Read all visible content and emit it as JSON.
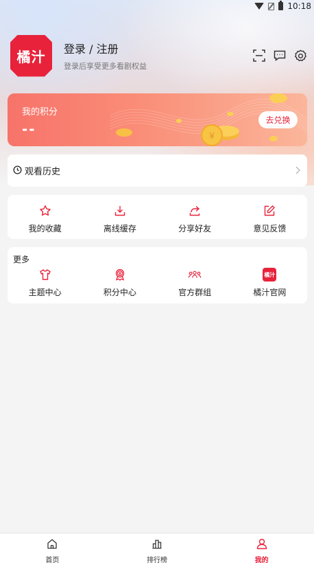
{
  "status_bar": {
    "time": "10:18",
    "icons": [
      "wifi-icon",
      "no-sim-icon",
      "battery-icon"
    ]
  },
  "header": {
    "logo_text": "橘汁",
    "login_title": "登录 / 注册",
    "login_subtitle": "登录后享受更多看剧权益",
    "icons": [
      "scan-icon",
      "message-icon",
      "settings-icon"
    ]
  },
  "points": {
    "title": "我的积分",
    "value": "--",
    "exchange_label": "去兑换"
  },
  "history": {
    "label": "观看历史"
  },
  "quick_actions": [
    {
      "label": "我的收藏",
      "icon": "star-icon"
    },
    {
      "label": "离线缓存",
      "icon": "download-icon"
    },
    {
      "label": "分享好友",
      "icon": "share-icon"
    },
    {
      "label": "意见反馈",
      "icon": "edit-icon"
    }
  ],
  "more": {
    "title": "更多",
    "items": [
      {
        "label": "主题中心",
        "icon": "shirt-icon"
      },
      {
        "label": "积分中心",
        "icon": "badge-icon"
      },
      {
        "label": "官方群组",
        "icon": "group-icon"
      },
      {
        "label": "橘汁官网",
        "icon": "site-logo-icon",
        "logo_text": "橘汁"
      }
    ]
  },
  "tabbar": [
    {
      "label": "首页",
      "icon": "home-icon",
      "active": false
    },
    {
      "label": "排行榜",
      "icon": "ranking-icon",
      "active": false
    },
    {
      "label": "我的",
      "icon": "profile-icon",
      "active": true
    }
  ],
  "colors": {
    "accent": "#e8223b",
    "page_bg": "#f4f4f4"
  }
}
